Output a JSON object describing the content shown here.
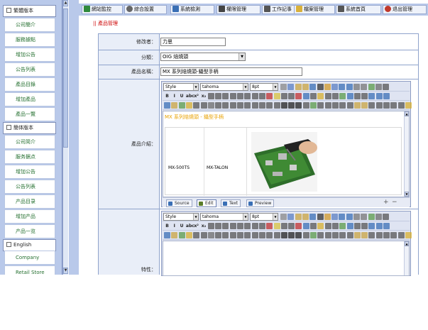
{
  "sidebar": {
    "sections": [
      {
        "title": "繁體版本",
        "items": [
          "公司簡介",
          "服務據點",
          "增加公告",
          "公告列表",
          "產品目錄",
          "增加產品",
          "產品一覽"
        ]
      },
      {
        "title": "簡体版本",
        "items": [
          "公司简介",
          "服务据点",
          "增加公告",
          "公告列表",
          "产品目录",
          "增加产品",
          "产品一览"
        ]
      },
      {
        "title": "English",
        "items": [
          "Company",
          "Retail Store"
        ]
      }
    ]
  },
  "topnav": [
    {
      "label": "網站監控",
      "icon": "monitor-icon",
      "color": "#2f8a3c"
    },
    {
      "label": "綜合設置",
      "icon": "gear-icon",
      "color": "#555555"
    },
    {
      "label": "系統檢測",
      "icon": "check-icon",
      "color": "#3a6fb5"
    },
    {
      "label": "權限管理",
      "icon": "permission-icon",
      "color": "#444444"
    },
    {
      "label": "工作記事",
      "icon": "notebook-icon",
      "color": "#4a4a4a"
    },
    {
      "label": "檔案管理",
      "icon": "folder-icon",
      "color": "#d9b13c"
    },
    {
      "label": "系統首頁",
      "icon": "home-icon",
      "color": "#555555"
    },
    {
      "label": "退出管理",
      "icon": "exit-icon",
      "color": "#c0392b"
    }
  ],
  "breadcrumb": "|| 產品管理",
  "form": {
    "author_label": "修改者：",
    "author_value": "力思",
    "category_label": "分類：",
    "category_value": "OIG 焙燒頭",
    "name_label": "產品名稱：",
    "name_value": "MX 系列焙燒頭-鑷型手柄",
    "intro_label": "產品介紹：",
    "feature_label": "特性："
  },
  "editor": {
    "style_value": "Style",
    "font_value": "tahoma",
    "size_value": "8pt",
    "content_title": "MX 系列焙燒頭 - 鑷型手柄",
    "table_cells": [
      "MX-500TS",
      "MX-TALON"
    ],
    "tabs": [
      "Source",
      "Edit",
      "Text",
      "Preview"
    ],
    "zoom_plus": "+",
    "zoom_minus": "−"
  },
  "colors": {
    "sidebar_bg": "#b9c9ea",
    "nav_text": "#257030",
    "breadcrumb": "#cc0000",
    "content_title": "#e8a100",
    "form_border": "#8fa3cc",
    "label_bg": "#e9eef8"
  }
}
